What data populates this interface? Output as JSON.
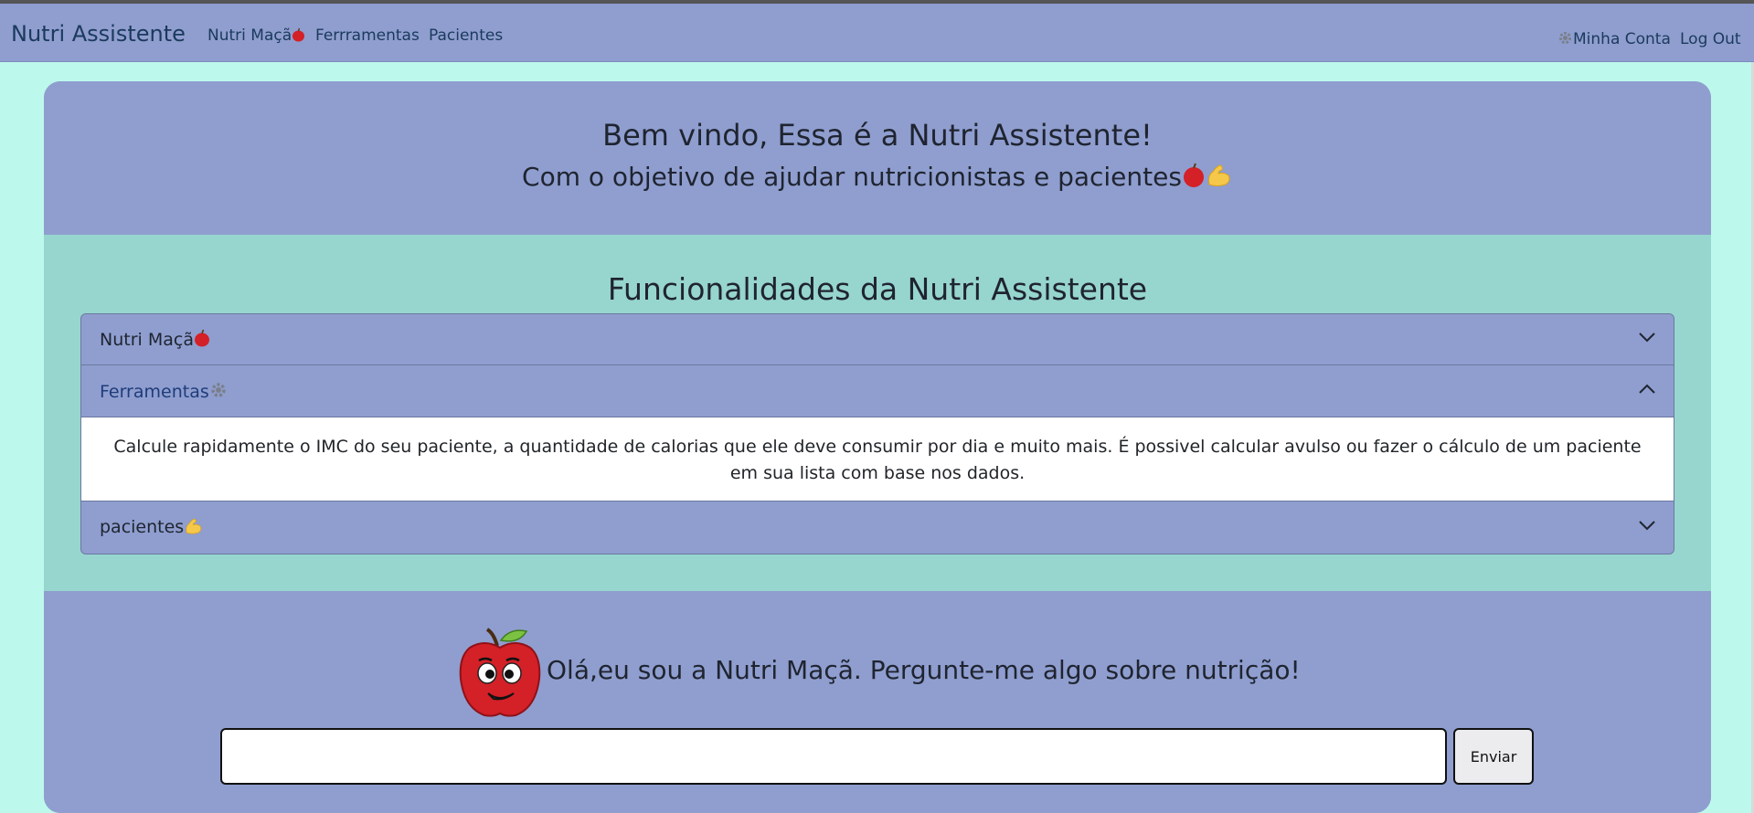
{
  "navbar": {
    "brand": "Nutri Assistente",
    "links": [
      "Nutri Maçã",
      "Ferrramentas",
      "Pacientes"
    ],
    "account_label": "Minha Conta",
    "logout_label": "Log Out"
  },
  "hero": {
    "title": "Bem vindo, Essa é a Nutri Assistente!",
    "subtitle": "Com o objetivo de ajudar nutricionistas e pacientes"
  },
  "features": {
    "title": "Funcionalidades da Nutri Assistente",
    "items": [
      {
        "label": "Nutri Maçã",
        "icon": "apple-icon",
        "expanded": false
      },
      {
        "label": "Ferramentas",
        "icon": "gear-icon",
        "expanded": true,
        "body": "Calcule rapidamente o IMC do seu paciente, a quantidade de calorias que ele deve consumir por dia e muito mais. É possivel calcular avulso ou fazer o cálculo de um paciente em sua lista com base nos dados."
      },
      {
        "label": "pacientes",
        "icon": "flexed-biceps-icon",
        "expanded": false
      }
    ]
  },
  "chat": {
    "greeting": "Olá,eu sou a Nutri Maçã. Pergunte-me algo sobre nutrição!",
    "input_value": "",
    "send_label": "Enviar"
  },
  "colors": {
    "page_bg": "#bdf8ec",
    "nav_bg": "#8f9ecf",
    "features_bg": "#97d5cf",
    "link_color": "#1b3a5c"
  }
}
